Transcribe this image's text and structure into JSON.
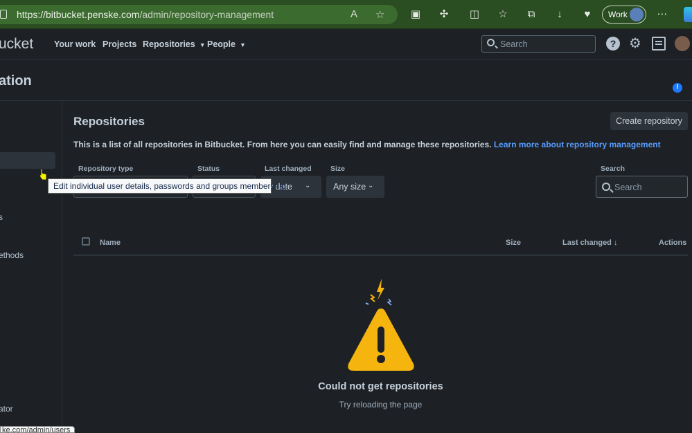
{
  "browser": {
    "url_host": "https://bitbucket.penske.com",
    "url_path": "/admin/repository-management",
    "profile_label": "Work"
  },
  "header": {
    "logo_text": "ucket",
    "nav": [
      "Your work",
      "Projects",
      "Repositories",
      "People"
    ],
    "search_placeholder": "Search",
    "help_glyph": "?"
  },
  "page": {
    "title": "ation",
    "info_glyph": "!"
  },
  "sidebar": {
    "items": [
      "s",
      "ethods",
      "ator"
    ]
  },
  "main": {
    "heading": "Repositories",
    "create_button": "Create repository",
    "description": "This is a list of all repositories in Bitbucket. From here you can easily find and manage these repositories.",
    "description_link": "Learn more about repository management",
    "filters": {
      "repository_type_label": "Repository type",
      "status_label": "Status",
      "last_changed_label": "Last changed",
      "last_changed_value": "ny date",
      "size_label": "Size",
      "size_value": "Any size",
      "search_label": "Search",
      "search_placeholder": "Search"
    },
    "table_headers": {
      "name": "Name",
      "size": "Size",
      "last_changed": "Last changed",
      "actions": "Actions"
    },
    "empty_state": {
      "title": "Could not get repositories",
      "subtitle": "Try reloading the page"
    }
  },
  "tooltip": {
    "text": "Edit individual user details, passwords and groups membership."
  },
  "status_bar": {
    "text": "ke.com/admin/users"
  },
  "colors": {
    "background": "#1d2125",
    "browser_bar": "#2a4d21",
    "link": "#579dff",
    "warning": "#f5b50e",
    "info": "#1d7afc"
  }
}
